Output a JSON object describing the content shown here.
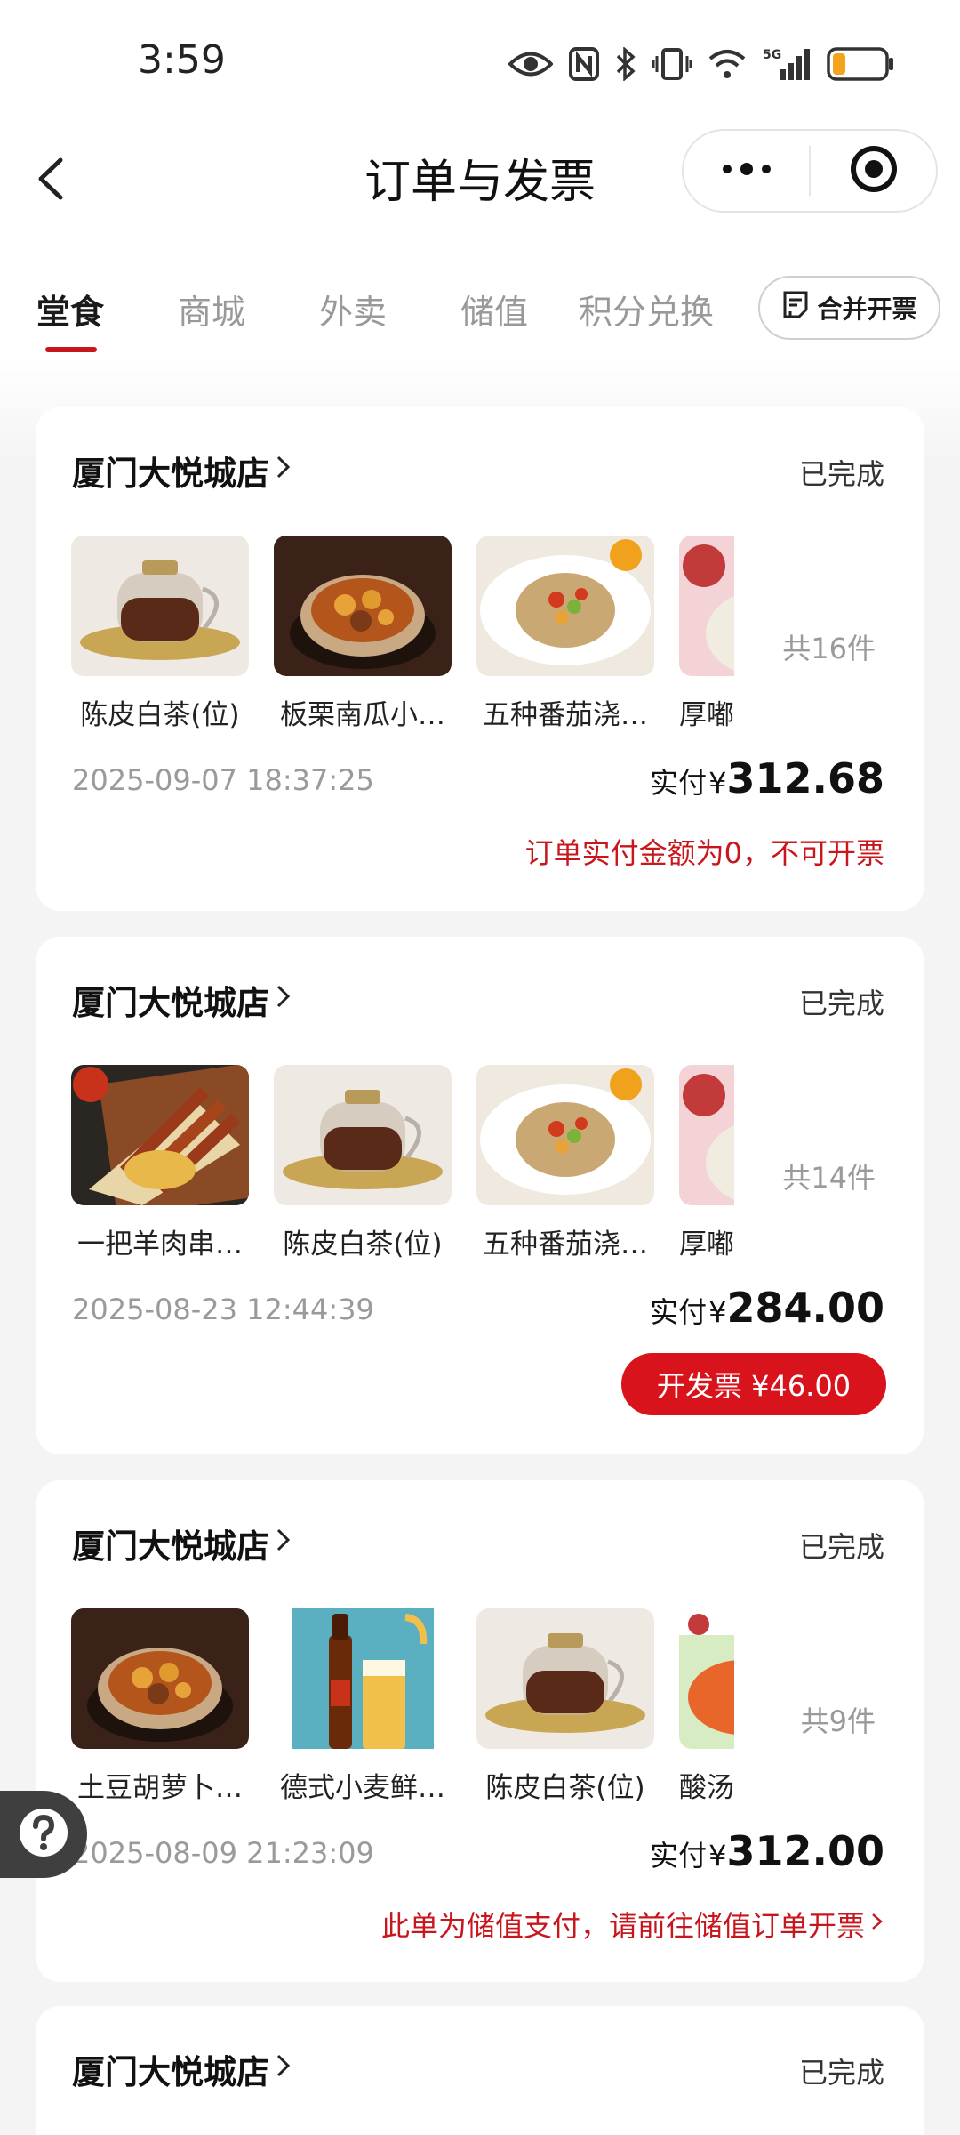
{
  "status_bar": {
    "time": "3:59",
    "icons": [
      "eye-icon",
      "nfc-icon",
      "bluetooth-icon",
      "vibrate-icon",
      "wifi-icon",
      "5g-signal-icon",
      "battery-low-icon"
    ],
    "network_label": "5G"
  },
  "nav": {
    "title": "订单与发票",
    "back_icon": "chevron-left-icon",
    "more_icon": "more-dots-icon",
    "target_icon": "target-circle-icon"
  },
  "tabs": [
    {
      "label": "堂食",
      "active": true
    },
    {
      "label": "商城",
      "active": false
    },
    {
      "label": "外卖",
      "active": false
    },
    {
      "label": "储值",
      "active": false
    },
    {
      "label": "积分兑换",
      "active": false
    }
  ],
  "merge_invoice": {
    "label": "合并开票",
    "icon": "invoice-icon"
  },
  "orders": [
    {
      "store": "厦门大悦城店",
      "status": "已完成",
      "items": [
        {
          "name": "陈皮白茶(位)",
          "image": "teapot"
        },
        {
          "name": "板栗南瓜小…",
          "image": "stew"
        },
        {
          "name": "五种番茄浇…",
          "image": "noodle"
        },
        {
          "name": "厚嘟",
          "image": "pink"
        }
      ],
      "count": "共16件",
      "date": "2025-09-07 18:37:25",
      "paid_label": "实付",
      "currency": "¥",
      "amount": "312.68",
      "note": "订单实付金额为0，不可开票"
    },
    {
      "store": "厦门大悦城店",
      "status": "已完成",
      "items": [
        {
          "name": "一把羊肉串…",
          "image": "skewer"
        },
        {
          "name": "陈皮白茶(位)",
          "image": "teapot"
        },
        {
          "name": "五种番茄浇…",
          "image": "noodle"
        },
        {
          "name": "厚嘟",
          "image": "pink"
        }
      ],
      "count": "共14件",
      "date": "2025-08-23 12:44:39",
      "paid_label": "实付",
      "currency": "¥",
      "amount": "284.00",
      "button": "开发票 ¥46.00"
    },
    {
      "store": "厦门大悦城店",
      "status": "已完成",
      "items": [
        {
          "name": "土豆胡萝卜…",
          "image": "stew"
        },
        {
          "name": "德式小麦鲜…",
          "image": "beer"
        },
        {
          "name": "陈皮白茶(位)",
          "image": "teapot"
        },
        {
          "name": "酸汤",
          "image": "soup"
        }
      ],
      "count": "共9件",
      "date": "2025-08-09 21:23:09",
      "paid_label": "实付",
      "currency": "¥",
      "amount": "312.00",
      "note": "此单为储值支付，请前往储值订单开票"
    },
    {
      "store": "厦门大悦城店",
      "status": "已完成"
    }
  ],
  "help": {
    "icon": "help-question-icon"
  },
  "colors": {
    "accent": "#c8161d",
    "button": "#d9131c",
    "muted": "#9a9a9a"
  }
}
